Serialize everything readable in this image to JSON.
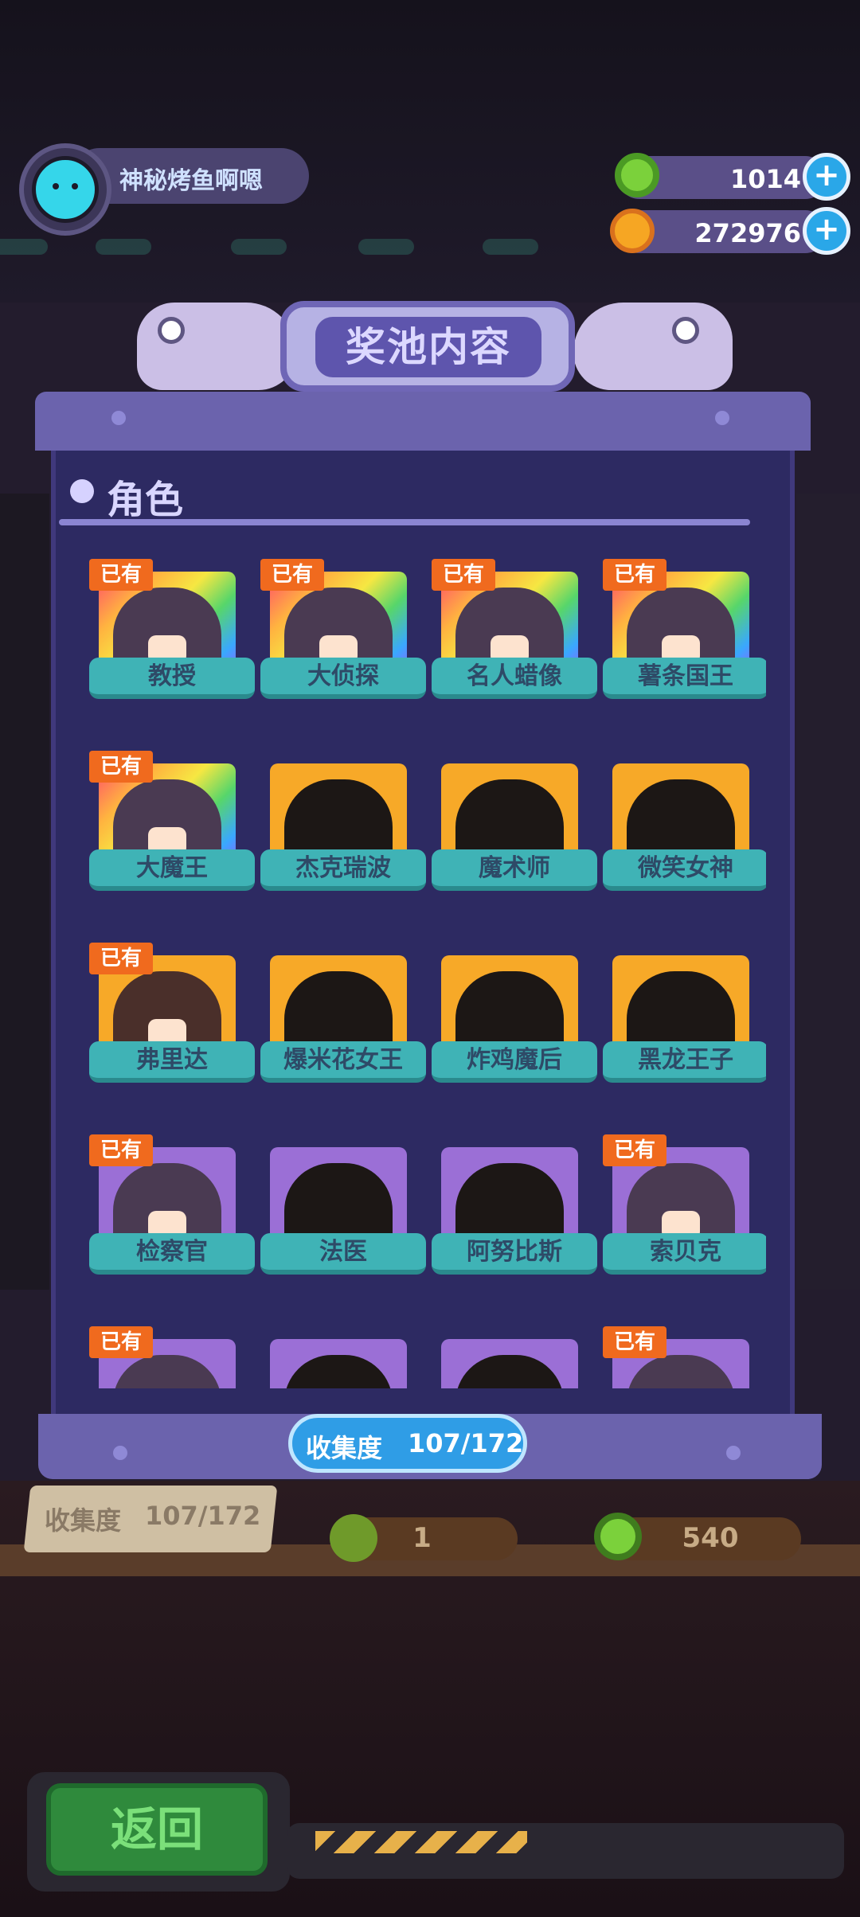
{
  "user": {
    "name": "神秘烤鱼啊嗯"
  },
  "currency": [
    {
      "icon": "donut-coin-icon",
      "value": "1014",
      "color": "#7bd13b"
    },
    {
      "icon": "planet-coin-icon",
      "value": "272976",
      "color": "#f6a623"
    }
  ],
  "title": "奖池内容",
  "section": "角色",
  "owned_label": "已有",
  "characters": [
    {
      "name": "教授",
      "owned": true,
      "style": "rainbow"
    },
    {
      "name": "大侦探",
      "owned": true,
      "style": "rainbow"
    },
    {
      "name": "名人蜡像",
      "owned": true,
      "style": "rainbow"
    },
    {
      "name": "薯条国王",
      "owned": true,
      "style": "rainbow"
    },
    {
      "name": "大魔王",
      "owned": true,
      "style": "rainbow"
    },
    {
      "name": "杰克瑞波",
      "owned": false,
      "style": "gold"
    },
    {
      "name": "魔术师",
      "owned": false,
      "style": "gold"
    },
    {
      "name": "微笑女神",
      "owned": false,
      "style": "gold"
    },
    {
      "name": "弗里达",
      "owned": true,
      "style": "gold"
    },
    {
      "name": "爆米花女王",
      "owned": false,
      "style": "gold"
    },
    {
      "name": "炸鸡魔后",
      "owned": false,
      "style": "gold"
    },
    {
      "name": "黑龙王子",
      "owned": false,
      "style": "gold"
    },
    {
      "name": "检察官",
      "owned": true,
      "style": "purple"
    },
    {
      "name": "法医",
      "owned": false,
      "style": "purple"
    },
    {
      "name": "阿努比斯",
      "owned": false,
      "style": "purple"
    },
    {
      "name": "索贝克",
      "owned": true,
      "style": "purple"
    },
    {
      "name": "",
      "owned": true,
      "style": "purple"
    },
    {
      "name": "",
      "owned": false,
      "style": "purple"
    },
    {
      "name": "",
      "owned": false,
      "style": "purple"
    },
    {
      "name": "",
      "owned": true,
      "style": "purple"
    }
  ],
  "collection": {
    "label": "收集度",
    "value": "107/172"
  },
  "background": {
    "plaque_label": "收集度",
    "plaque_value": "107/172",
    "price_1": "1",
    "price_2": "540"
  },
  "back_button": "返回"
}
